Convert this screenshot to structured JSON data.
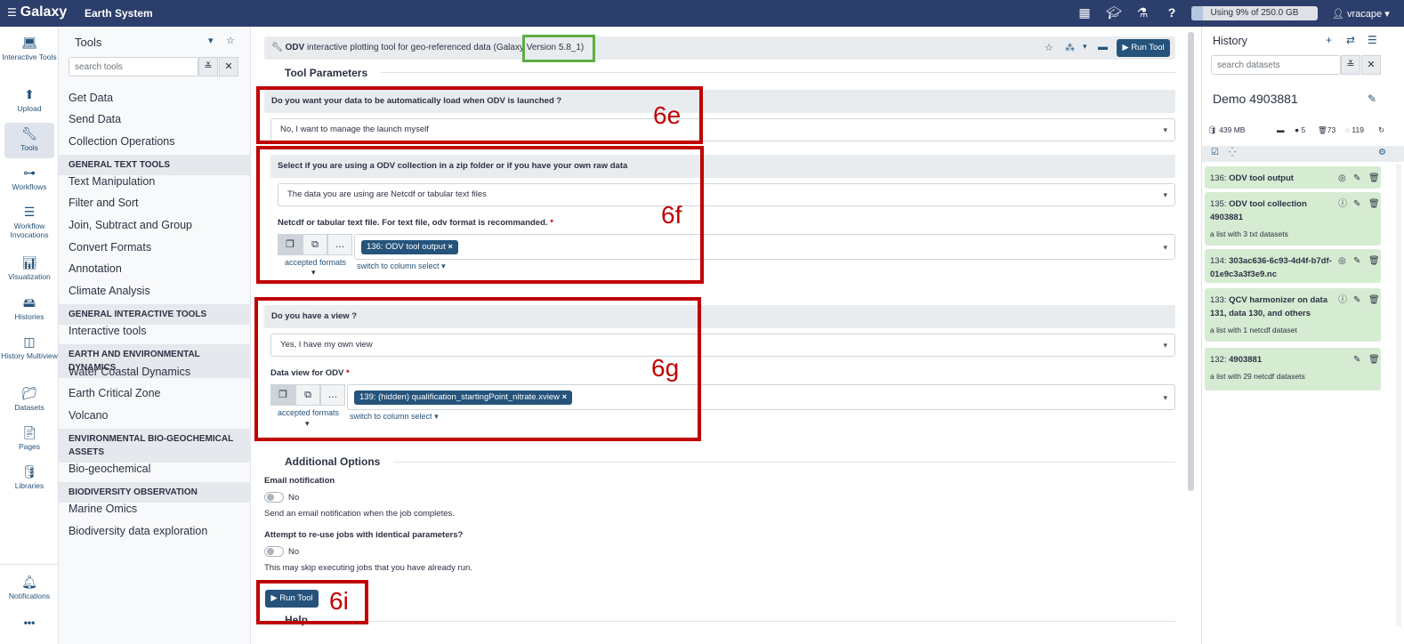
{
  "topbar": {
    "brand": "Galaxy",
    "site": "Earth System",
    "quota": "Using 9% of 250.0 GB",
    "quota_fraction": 0.09,
    "user": "vracape",
    "icons": [
      "grid-icon",
      "graduation-cap-icon",
      "flask-icon",
      "help-icon"
    ]
  },
  "activity": [
    {
      "name": "interactive-tools",
      "icon": "laptop-icon",
      "label": "Interactive Tools"
    },
    {
      "name": "upload",
      "icon": "upload-icon",
      "label": "Upload"
    },
    {
      "name": "tools",
      "icon": "wrench-icon",
      "label": "Tools"
    },
    {
      "name": "workflows",
      "icon": "sitemap-icon",
      "label": "Workflows"
    },
    {
      "name": "workflow-invocations",
      "icon": "list-icon",
      "label": "Workflow Invocations"
    },
    {
      "name": "visualization",
      "icon": "chart-icon",
      "label": "Visualization"
    },
    {
      "name": "histories",
      "icon": "hdd-icon",
      "label": "Histories"
    },
    {
      "name": "history-multiview",
      "icon": "columns-icon",
      "label": "History Multiview"
    },
    {
      "name": "datasets",
      "icon": "folder-icon",
      "label": "Datasets"
    },
    {
      "name": "pages",
      "icon": "file-icon",
      "label": "Pages"
    },
    {
      "name": "libraries",
      "icon": "database-icon",
      "label": "Libraries"
    },
    {
      "name": "notifications",
      "icon": "bell-icon",
      "label": "Notifications"
    },
    {
      "name": "more",
      "icon": "ellipsis-icon",
      "label": "•••"
    }
  ],
  "toolpanel": {
    "title": "Tools",
    "search_placeholder": "search tools",
    "items": [
      "Get Data",
      "Send Data",
      "Collection Operations"
    ],
    "sections": [
      {
        "title": "GENERAL TEXT TOOLS",
        "items": [
          "Text Manipulation",
          "Filter and Sort",
          "Join, Subtract and Group",
          "Convert Formats",
          "Annotation",
          "Climate Analysis"
        ]
      },
      {
        "title": "GENERAL INTERACTIVE TOOLS",
        "items": [
          "Interactive tools"
        ]
      },
      {
        "title": "EARTH AND ENVIRONMENTAL DYNAMICS",
        "items": [
          "Water Coastal Dynamics",
          "Earth Critical Zone",
          "Volcano"
        ]
      },
      {
        "title": "ENVIRONMENTAL BIO-GEOCHEMICAL ASSETS",
        "items": [
          "Bio-geochemical"
        ]
      },
      {
        "title": "BIODIVERSITY OBSERVATION",
        "items": [
          "Marine Omics",
          "Biodiversity data exploration"
        ]
      }
    ]
  },
  "tool": {
    "name": "ODV",
    "description": "interactive plotting tool for geo-referenced data (Galaxy Version 5.8_1)",
    "run_label": "Run Tool",
    "parameters_title": "Tool Parameters",
    "q1_label": "Do you want your data to be automatically load when ODV is launched ?",
    "q1_value": "No, I want to manage the launch myself",
    "q2_label": "Select if you are using a ODV collection in a zip folder or if you have your own raw data",
    "q2_value": "The data you are using are Netcdf or tabular text files",
    "q2_input_label": "Netcdf or tabular text file. For text file, odv format is recommanded.",
    "q2_input_value": "136: ODV tool output",
    "accepted_formats": "accepted formats",
    "switch_column": "switch to column select",
    "q3_label": "Do you have a view ?",
    "q3_value": "Yes, I have my own view",
    "q3_input_label": "Data view for ODV",
    "q3_input_value": "139: (hidden) qualification_startingPoint_nitrate.xview",
    "additional_title": "Additional Options",
    "email_label": "Email notification",
    "email_value": "No",
    "email_help": "Send an email notification when the job completes.",
    "reuse_label": "Attempt to re-use jobs with identical parameters?",
    "reuse_value": "No",
    "reuse_help": "This may skip executing jobs that you have already run.",
    "help_title": "Help"
  },
  "annotations": {
    "e": "6e",
    "f": "6f",
    "g": "6g",
    "i": "6i"
  },
  "history": {
    "title": "History",
    "search_placeholder": "search datasets",
    "name": "Demo 4903881",
    "size": "439 MB",
    "count_visible": "5",
    "count_deleted": "73",
    "count_hidden": "119",
    "items": [
      {
        "num": "136:",
        "title": "ODV tool output",
        "sub": ""
      },
      {
        "num": "135:",
        "title": "ODV tool collection 4903881",
        "sub": "a list with 3 txt datasets"
      },
      {
        "num": "134:",
        "title": "303ac636-6c93-4d4f-b7df-01e9c3a3f3e9.nc",
        "sub": ""
      },
      {
        "num": "133:",
        "title": "QCV harmonizer on data 131, data 130, and others",
        "sub": "a list with 1 netcdf dataset"
      },
      {
        "num": "132:",
        "title": "4903881",
        "sub": "a list with 29 netcdf datasets"
      }
    ]
  },
  "colors": {
    "brand": "#2c3e6b",
    "primary": "#25537b",
    "history_ok": "#d6ecd2",
    "annotation": "#c00000",
    "highlight": "#5fad41"
  }
}
